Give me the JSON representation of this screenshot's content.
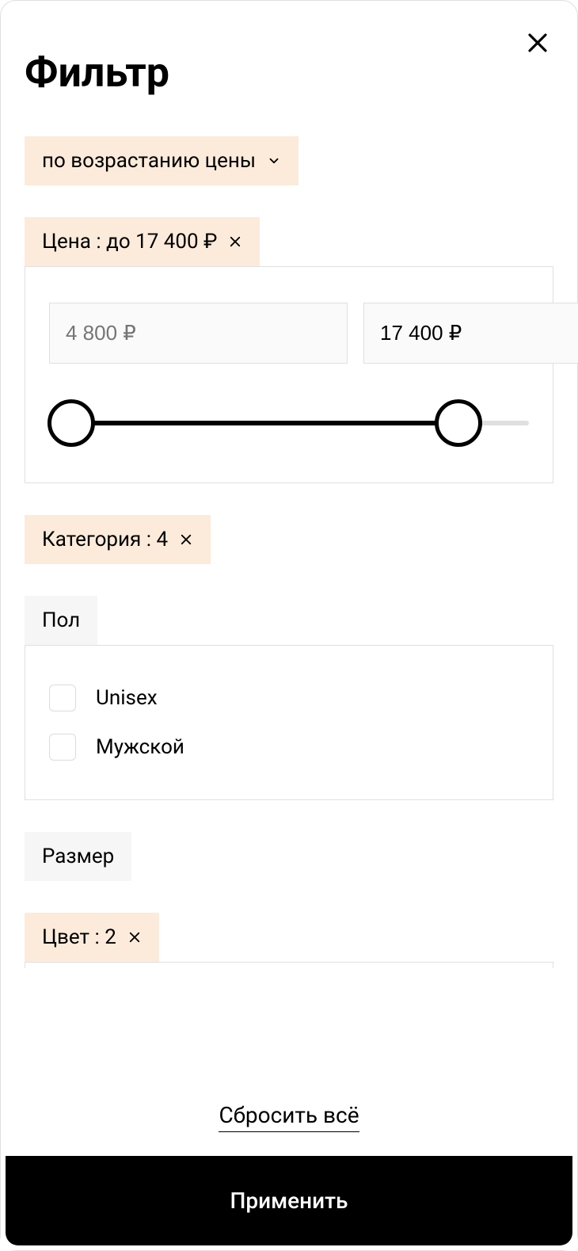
{
  "header": {
    "title": "Фильтр"
  },
  "sort": {
    "label": "по возрастанию цены"
  },
  "price": {
    "chip_label": "Цена : до 17 400 ₽",
    "min_placeholder": "4 800 ₽",
    "max_value": "17 400 ₽"
  },
  "category": {
    "chip_label": "Категория : 4"
  },
  "gender": {
    "chip_label": "Пол",
    "options": [
      {
        "label": "Unisex"
      },
      {
        "label": "Мужской"
      }
    ]
  },
  "size": {
    "chip_label": "Размер"
  },
  "color": {
    "chip_label": "Цвет : 2"
  },
  "footer": {
    "reset_label": "Сбросить всё",
    "apply_label": "Применить"
  }
}
